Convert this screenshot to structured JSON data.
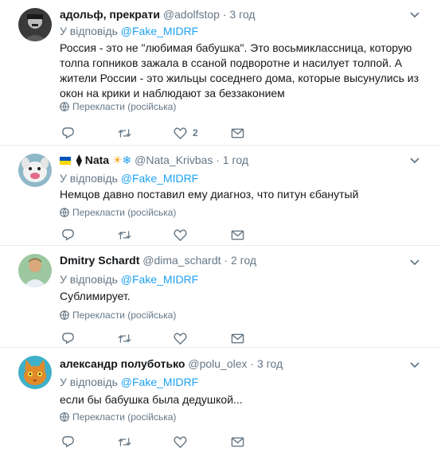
{
  "common": {
    "reply_prefix": "У відповідь",
    "translate_label": "Перекласти (російська)",
    "dot": "·"
  },
  "tweets": [
    {
      "name": "адольф, прекрати",
      "handle": "@adolfstop",
      "time": "3 год",
      "mention": "@Fake_MIDRF",
      "text": "Россия - это не \"любимая бабушка\". Это восьмиклассница, которую толпа гопников зажала в ссаной подворотне и насилует толпой. А жители России - это жильцы соседнего дома, которые высунулись из окон на крики и наблюдают за беззаконием",
      "like_count": "2"
    },
    {
      "name": "Nata",
      "handle": "@Nata_Krivbas",
      "time": "1 год",
      "mention": "@Fake_MIDRF",
      "text": "Немцов давно поставил ему диагноз, что питун єбанутый",
      "name_prefix": "🇺🇦 ⧫",
      "name_suffix": "🌞❄"
    },
    {
      "name": "Dmitry Schardt",
      "handle": "@dima_schardt",
      "time": "2 год",
      "mention": "@Fake_MIDRF",
      "text": "Сублимирует."
    },
    {
      "name": "александр полуботько",
      "handle": "@polu_olex",
      "time": "3 год",
      "mention": "@Fake_MIDRF",
      "text": "если бы бабушка была дедушкой..."
    }
  ],
  "colors": {
    "link": "#1da1f2",
    "muted": "#657786",
    "text": "#14171a",
    "divider": "#e6ecf0"
  },
  "icons": {
    "reply": "reply-icon",
    "retweet": "retweet-icon",
    "like": "heart-icon",
    "dm": "envelope-icon",
    "translate": "globe-icon",
    "more": "chevron-down-icon"
  }
}
